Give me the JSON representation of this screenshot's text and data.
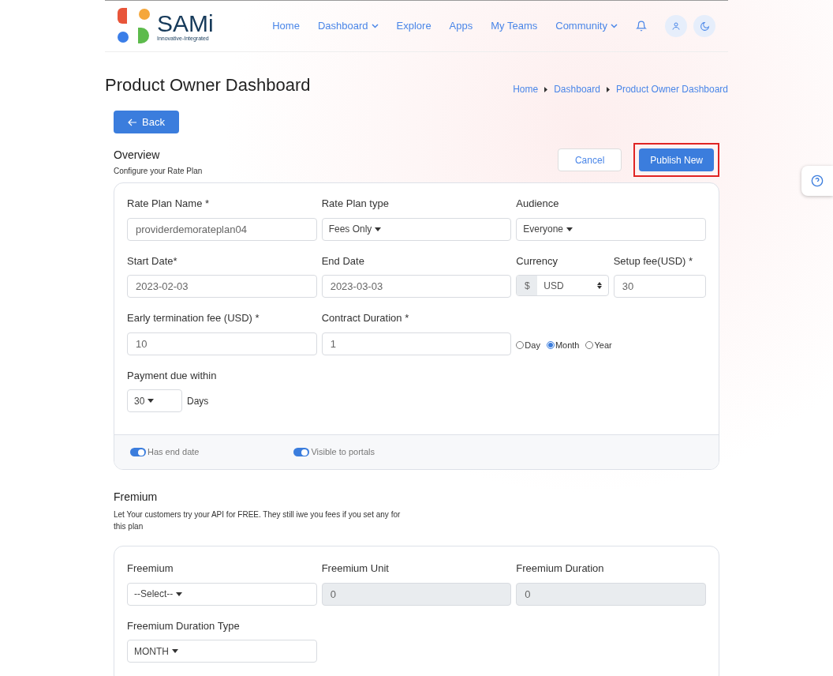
{
  "nav": {
    "logo_text": "SAMi",
    "logo_tagline": "Innovative-Integrated",
    "links": [
      {
        "label": "Home",
        "dropdown": false
      },
      {
        "label": "Dashboard",
        "dropdown": true
      },
      {
        "label": "Explore",
        "dropdown": false
      },
      {
        "label": "Apps",
        "dropdown": false
      },
      {
        "label": "My Teams",
        "dropdown": false
      },
      {
        "label": "Community",
        "dropdown": true
      }
    ]
  },
  "page_title": "Product Owner Dashboard",
  "breadcrumb": [
    "Home",
    "Dashboard",
    "Product Owner Dashboard"
  ],
  "back_button": "Back",
  "overview": {
    "title": "Overview",
    "subtitle": "Configure your Rate Plan"
  },
  "actions": [
    {
      "label": "Cancel",
      "kind": "secondary",
      "highlighted": false
    },
    {
      "label": "Publish New",
      "kind": "primary",
      "highlighted": true
    }
  ],
  "rate_plan": {
    "rate_plan_name": {
      "label": "Rate Plan Name *",
      "value": "providerdemorateplan04"
    },
    "rate_plan_type": {
      "label": "Rate Plan type",
      "value": "Fees Only"
    },
    "audience": {
      "label": "Audience",
      "value": "Everyone"
    },
    "start_date": {
      "label": "Start Date*",
      "value": "2023-02-03"
    },
    "end_date": {
      "label": "End Date",
      "value": "2023-03-03"
    },
    "currency": {
      "label": "Currency",
      "prefix": "$",
      "value": "USD"
    },
    "setup_fee": {
      "label": "Setup fee(USD) *",
      "value": "30"
    },
    "early_termination_fee": {
      "label": "Early termination fee (USD) *",
      "value": "10"
    },
    "contract_duration": {
      "label": "Contract Duration *",
      "value": "1",
      "options": [
        {
          "label": "Day",
          "selected": false
        },
        {
          "label": "Month",
          "selected": true
        },
        {
          "label": "Year",
          "selected": false
        }
      ]
    },
    "payment_due_within": {
      "label": "Payment due within",
      "value": "30",
      "unit": "Days"
    },
    "toggles": [
      {
        "label": "Has end date",
        "on": true
      },
      {
        "label": "Visible to portals",
        "on": true
      }
    ]
  },
  "fremium": {
    "title": "Fremium",
    "description": "Let Your customers try your API for FREE. They still iwe you fees if you set any for this plan",
    "freemium": {
      "label": "Freemium",
      "value": "--Select--"
    },
    "freemium_unit": {
      "label": "Freemium Unit",
      "value": "0",
      "disabled": true
    },
    "freemium_duration": {
      "label": "Freemium Duration",
      "value": "0",
      "disabled": true
    },
    "freemium_duration_type": {
      "label": "Freemium Duration Type",
      "value": "MONTH"
    }
  }
}
